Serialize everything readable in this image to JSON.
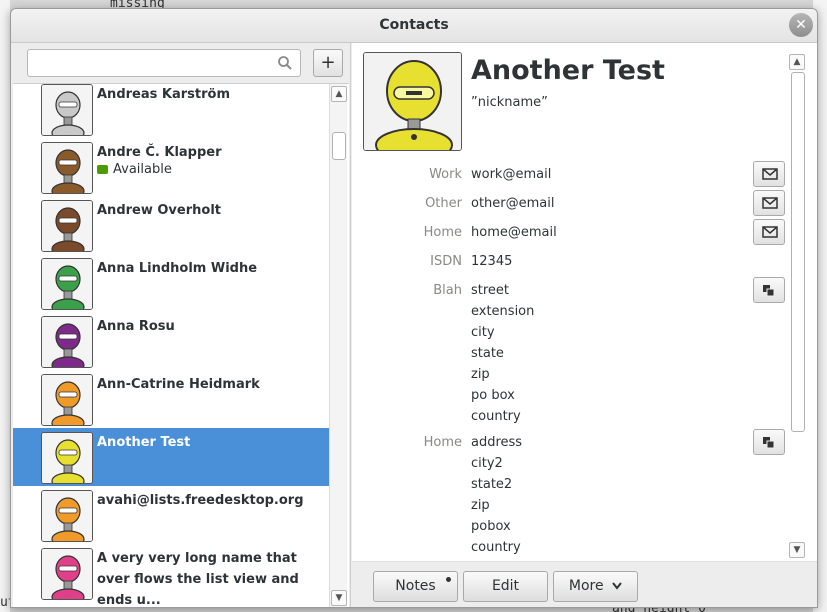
{
  "background": {
    "top_text": "missing",
    "bottom_left_text": "ution",
    "bottom_right_text": "and height 0"
  },
  "window": {
    "title": "Contacts",
    "close_label": "✕"
  },
  "search": {
    "value": "",
    "placeholder": "",
    "add_label": "+"
  },
  "contacts": [
    {
      "name": "Andreas Karström",
      "status": "",
      "avatar_color": "#c9c9c9"
    },
    {
      "name": "Andre Č. Klapper",
      "status": "Available",
      "avatar_color": "#8b5a2b"
    },
    {
      "name": "Andrew Overholt",
      "status": "",
      "avatar_color": "#7a4a2a"
    },
    {
      "name": "Anna Lindholm Widhe",
      "status": "",
      "avatar_color": "#3aa14a"
    },
    {
      "name": "Anna Rosu",
      "status": "",
      "avatar_color": "#7d2a8a"
    },
    {
      "name": "Ann-Catrine Heidmark",
      "status": "",
      "avatar_color": "#f09a2a"
    },
    {
      "name": "Another Test",
      "status": "",
      "avatar_color": "#e8e030",
      "selected": true
    },
    {
      "name": "avahi@lists.freedesktop.org",
      "status": "",
      "avatar_color": "#f09a2a"
    },
    {
      "name": "A very very long name that over flows the list view and ends u...",
      "status": "",
      "avatar_color": "#e0408a"
    }
  ],
  "detail": {
    "name": "Another Test",
    "nickname": "”nickname”",
    "fields": [
      {
        "label": "Work",
        "values": [
          "work@email"
        ],
        "action": "mail-icon"
      },
      {
        "label": "Other",
        "values": [
          "other@email"
        ],
        "action": "mail-icon"
      },
      {
        "label": "Home",
        "values": [
          "home@email"
        ],
        "action": "mail-icon"
      },
      {
        "label": "ISDN",
        "values": [
          "12345"
        ],
        "action": ""
      },
      {
        "label": "Blah",
        "values": [
          "street",
          "extension",
          "city",
          "state",
          "zip",
          "po box",
          "country"
        ],
        "action": "copy-icon"
      },
      {
        "label": "Home",
        "values": [
          "address",
          "city2",
          "state2",
          "zip",
          "pobox",
          "country"
        ],
        "action": "copy-icon"
      }
    ]
  },
  "buttons": {
    "notes": "Notes",
    "edit": "Edit",
    "more": "More"
  },
  "colors": {
    "selection": "#4a90d9",
    "presence_available": "#4e9a06"
  }
}
